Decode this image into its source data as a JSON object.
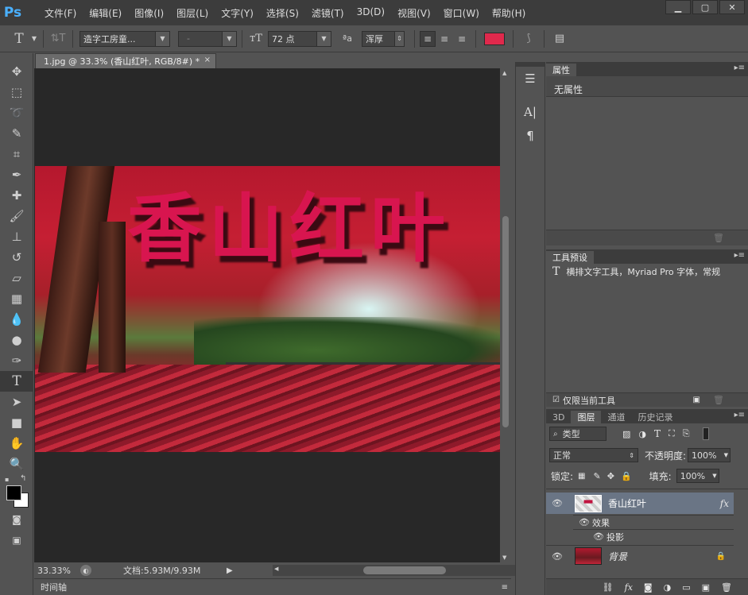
{
  "app": {
    "logo": "Ps"
  },
  "menu": [
    "文件(F)",
    "编辑(E)",
    "图像(I)",
    "图层(L)",
    "文字(Y)",
    "选择(S)",
    "滤镜(T)",
    "3D(D)",
    "视图(V)",
    "窗口(W)",
    "帮助(H)"
  ],
  "window_controls": {
    "min": "▁",
    "max": "▢",
    "close": "✕"
  },
  "options": {
    "font_family": "造字工房童...",
    "font_style": "-",
    "font_size": "72 点",
    "aa_label": "ªa",
    "anti_alias": "浑厚",
    "text_color": "#e0294c"
  },
  "document": {
    "tab_title": "1.jpg @ 33.3% (香山红叶, RGB/8#) *",
    "close": "×",
    "canvas_text": "香山红叶",
    "zoom": "33.33%",
    "doc_size": "文档:5.93M/9.93M"
  },
  "timeline": {
    "label": "时间轴"
  },
  "properties": {
    "tab": "属性",
    "message": "无属性"
  },
  "tool_presets": {
    "tab": "工具预设",
    "item": "横排文字工具，Myriad Pro 字体，常规",
    "current_only": "仅限当前工具"
  },
  "layers_panel": {
    "tabs": [
      "3D",
      "图层",
      "通道",
      "历史记录"
    ],
    "filter_type": "类型",
    "blend_mode": "正常",
    "opacity_label": "不透明度:",
    "opacity": "100%",
    "lock_label": "锁定:",
    "fill_label": "填充:",
    "fill": "100%",
    "layers": [
      {
        "name": "香山红叶",
        "fx": "fx",
        "effects_label": "效果",
        "sub_effect": "投影"
      },
      {
        "name": "背景"
      }
    ]
  }
}
